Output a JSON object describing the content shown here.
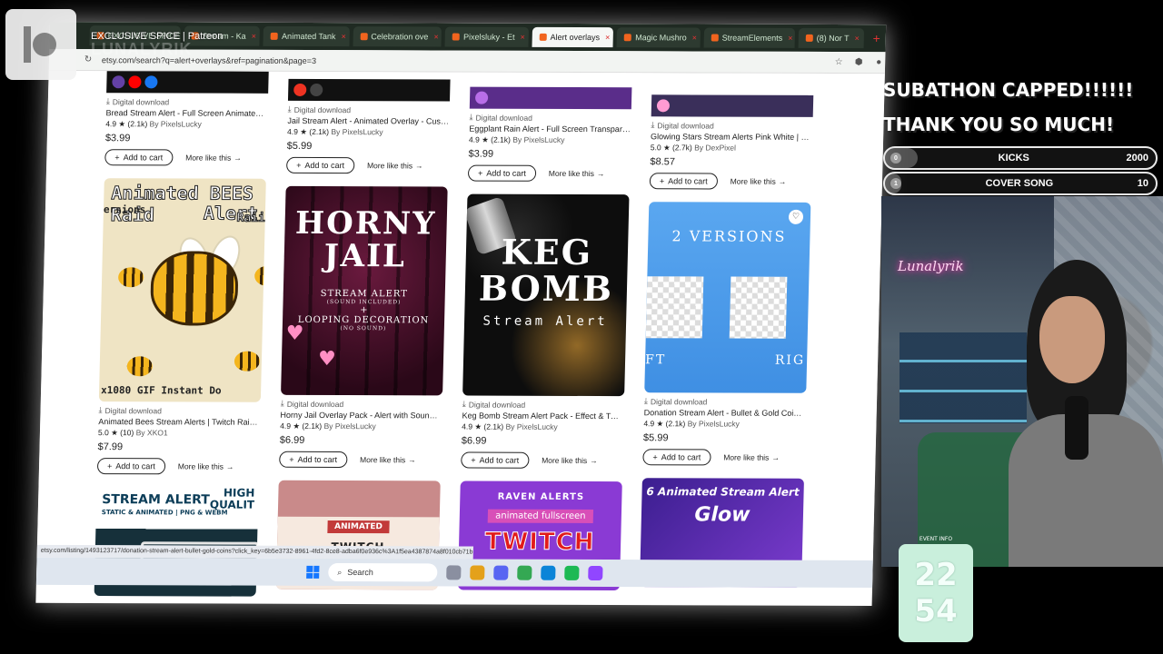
{
  "browser": {
    "tabs": [
      {
        "label": "EXCLUSIVE SPICE | Patreon",
        "active": false
      },
      {
        "label": "Stream - Ka",
        "active": false
      },
      {
        "label": "Animated Tank",
        "active": false
      },
      {
        "label": "Celebration ove",
        "active": false
      },
      {
        "label": "Pixelsluky - Et",
        "active": false
      },
      {
        "label": "Alert overlays",
        "active": true
      },
      {
        "label": "Magic Mushro",
        "active": false
      },
      {
        "label": "StreamElements",
        "active": false
      },
      {
        "label": "(8) Nor T",
        "active": false
      }
    ],
    "url": "etsy.com/search?q=alert+overlays&ref=pagination&page=3",
    "status_url": "etsy.com/listing/1493123717/donation-stream-alert-bullet-gold-coins?click_key=6b5e3732-8961-4fd2-8ce8-adba6f0e936c%3A1f5ea4387874a8f010cb71bb60e3b8e9...",
    "taskbar_search": "Search"
  },
  "products": {
    "row0": [
      {
        "dl": "Digital download",
        "title": "Bread Stream Alert - Full Screen Animated Ov...",
        "rating": "4.9",
        "reviews": "(2.1k)",
        "shop": "By PixelsLucky",
        "price": "$3.99"
      },
      {
        "dl": "Digital download",
        "title": "Jail Stream Alert - Animated Overlay - Custom ...",
        "rating": "4.9",
        "reviews": "(2.1k)",
        "shop": "By PixelsLucky",
        "price": "$5.99"
      },
      {
        "dl": "Digital download",
        "title": "Eggplant Rain Alert - Full Screen Transparent ...",
        "rating": "4.9",
        "reviews": "(2.1k)",
        "shop": "By PixelsLucky",
        "price": "$3.99"
      },
      {
        "dl": "Digital download",
        "title": "Glowing Stars Stream Alerts Pink White | Full ...",
        "rating": "5.0",
        "reviews": "(2.7k)",
        "shop": "By DexPixel",
        "price": "$8.57"
      }
    ],
    "row1": [
      {
        "dl": "Digital download",
        "title": "Animated Bees Stream Alerts | Twitch Raid ale...",
        "rating": "5.0",
        "reviews": "(10)",
        "shop": "By XKO1",
        "price": "$7.99"
      },
      {
        "dl": "Digital download",
        "title": "Horny Jail Overlay Pack - Alert with Sound & L...",
        "rating": "4.9",
        "reviews": "(2.1k)",
        "shop": "By PixelsLucky",
        "price": "$6.99"
      },
      {
        "dl": "Digital download",
        "title": "Keg Bomb Stream Alert Pack - Effect & Twitch ...",
        "rating": "4.9",
        "reviews": "(2.1k)",
        "shop": "By PixelsLucky",
        "price": "$6.99"
      },
      {
        "dl": "Digital download",
        "title": "Donation Stream Alert - Bullet & Gold Coins A...",
        "rating": "4.9",
        "reviews": "(2.1k)",
        "shop": "By PixelsLucky",
        "price": "$5.99"
      }
    ],
    "add_to_cart": "Add to cart",
    "more_like_this": "More like this"
  },
  "artwork": {
    "bees": {
      "title1": "Animated BEES Raid",
      "title2": "Alert",
      "side": "ersions",
      "raid": "Raii",
      "footer": "x1080 GIF  Instant Do"
    },
    "jail": {
      "line1": "HORNY",
      "line2": "JAIL",
      "sub1": "STREAM ALERT",
      "sub2": "(SOUND INCLUDED)",
      "plus": "+",
      "sub3": "LOOPING DECORATION",
      "sub4": "(NO SOUND)"
    },
    "keg": {
      "line1": "KEG",
      "line2": "BOMB",
      "sub": "Stream Alert"
    },
    "versions": {
      "title": "2 VERSIONS",
      "left": "FT",
      "right": "RIG"
    },
    "stream_alert": {
      "title": "STREAM ALERT",
      "sub": "STATIC & ANIMATED | PNG & WEBM",
      "quality1": "HIGH",
      "quality2": "QUALIT"
    },
    "animated_raid": {
      "tag": "ANIMATED",
      "text": "TWITCH"
    },
    "raven": {
      "title": "RAVEN ALERTS",
      "pill": "animated fullscreen",
      "big": "TWITCH"
    },
    "glow": {
      "title": "6 Animated Stream Alert",
      "big": "Glow"
    }
  },
  "overlay": {
    "patreon_label": "EXCLUSIVE SPICE | Patreon",
    "brand_ghost": "LUNALYRIK",
    "banner_line1": "SUBATHON CAPPED!!!!!!",
    "banner_line2": "THANK YOU SO MUCH!",
    "goals": [
      {
        "index": "0",
        "label": "KICKS",
        "target": "2000",
        "progress": 0.12
      },
      {
        "index": "1",
        "label": "COVER SONG",
        "target": "10",
        "progress": 0.06
      }
    ],
    "neon_sign": "Lunalyrik",
    "clock_label": "EVENT INFO",
    "clock_top": "22",
    "clock_bottom": "54"
  }
}
